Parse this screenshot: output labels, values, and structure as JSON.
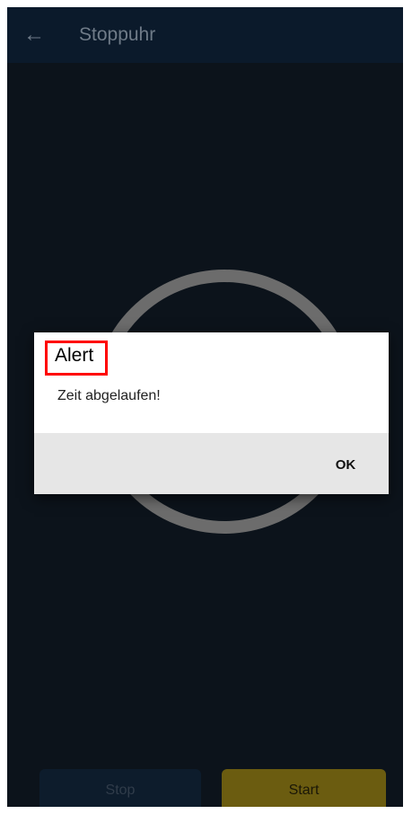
{
  "header": {
    "title": "Stoppuhr",
    "back_icon": "←"
  },
  "controls": {
    "stop_label": "Stop",
    "start_label": "Start"
  },
  "dialog": {
    "title": "Alert",
    "message": "Zeit abgelaufen!",
    "ok_label": "OK"
  },
  "colors": {
    "background": "#0c131b",
    "appbar": "#0b1a2b",
    "ring": "#6c6c6c",
    "start_button": "#6b5c10",
    "highlight": "#ff0000"
  }
}
